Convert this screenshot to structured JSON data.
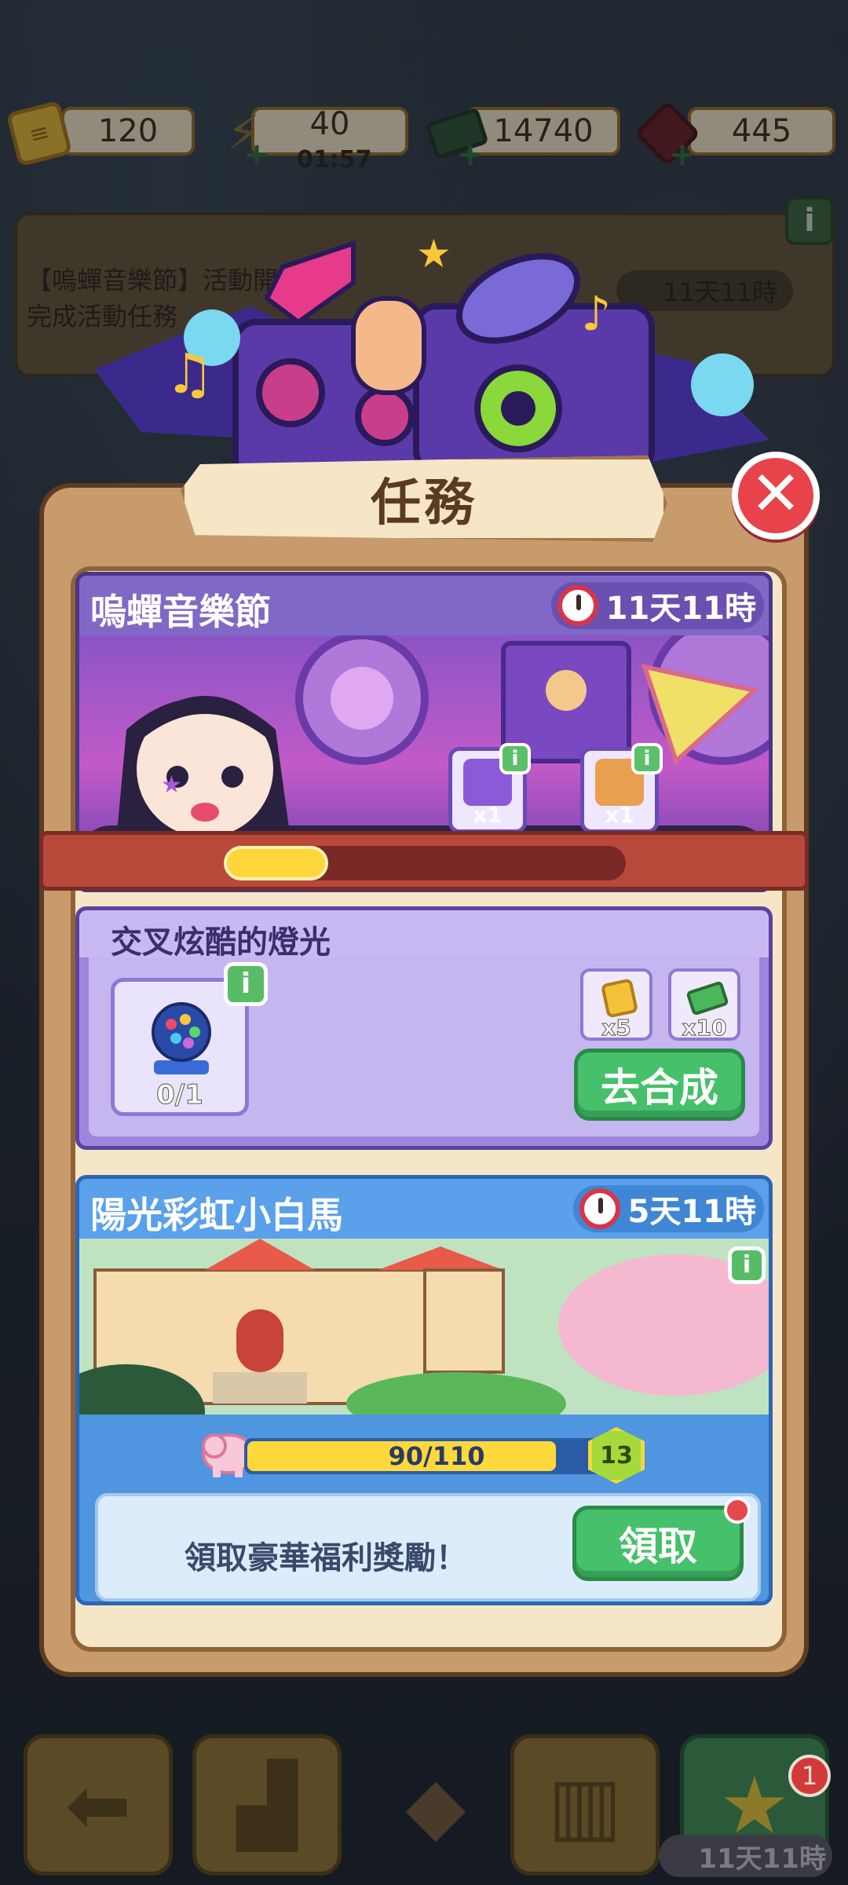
{
  "currencies": {
    "tickets": "120",
    "energy": "40",
    "energy_timer": "01:57",
    "cash": "14740",
    "gems": "445"
  },
  "event_banner": {
    "line1": "【嗚蟬音樂節】活動開始",
    "line2": "完成活動任務",
    "timer": "11天11時"
  },
  "panel": {
    "title": "任務"
  },
  "event_card": {
    "title": "嗚蟬音樂節",
    "timer": "11天11時",
    "rewards": [
      {
        "icon": "music-chest-icon",
        "qty": "x1"
      },
      {
        "icon": "music-box-icon",
        "qty": "x1"
      }
    ],
    "progress_fraction": 0.26
  },
  "task_card": {
    "title": "交叉炫酷的燈光",
    "item_icon": "spotlight-icon",
    "item_progress": "0/1",
    "rewards": [
      {
        "icon": "ticket-icon",
        "qty": "x5"
      },
      {
        "icon": "cash-icon",
        "qty": "x10"
      }
    ],
    "button": "去合成"
  },
  "pony_card": {
    "title": "陽光彩虹小白馬",
    "timer": "5天11時",
    "progress_text": "90/110",
    "progress_fraction": 0.818,
    "level": "13",
    "claim_text": "領取豪華福利獎勵！",
    "claim_button": "領取"
  },
  "bottom_nav": {
    "badge": "1",
    "timer": "11天11時"
  },
  "colors": {
    "close": "#e8424a",
    "green_button": "#46c06a",
    "event_purple": "#7058b8",
    "pony_blue": "#4a8ede",
    "progress_yellow": "#ffd53c"
  }
}
